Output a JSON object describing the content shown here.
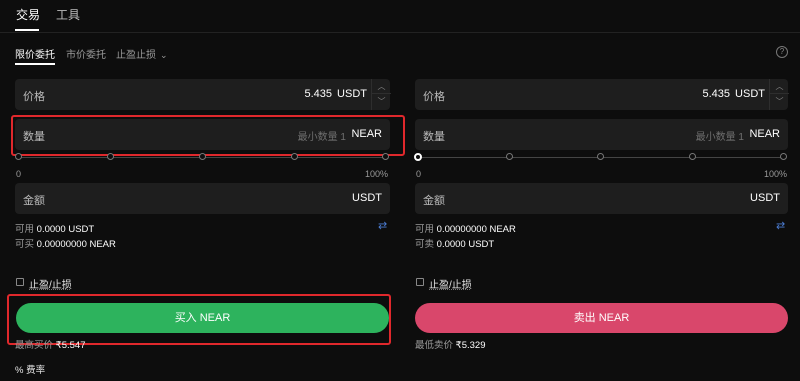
{
  "top_tabs": [
    "交易",
    "工具"
  ],
  "order_tabs": [
    "限价委托",
    "市价委托",
    "止盈止损"
  ],
  "buy": {
    "price_label": "价格",
    "price_value": "5.435",
    "price_unit": "USDT",
    "qty_label": "数量",
    "qty_placeholder": "最小数量 1",
    "qty_unit": "NEAR",
    "slider_min": "0",
    "slider_max": "100%",
    "amount_label": "金额",
    "amount_unit": "USDT",
    "avail_label": "可用",
    "avail_value": "0.0000 USDT",
    "can_label": "可买",
    "can_value": "0.00000000 NEAR",
    "tpsl_label": "止盈/止损",
    "button_label": "买入 NEAR",
    "ref_label": "最高买价",
    "ref_value": "₹5.547"
  },
  "sell": {
    "price_label": "价格",
    "price_value": "5.435",
    "price_unit": "USDT",
    "qty_label": "数量",
    "qty_placeholder": "最小数量 1",
    "qty_unit": "NEAR",
    "slider_min": "0",
    "slider_max": "100%",
    "amount_label": "金额",
    "amount_unit": "USDT",
    "avail_label": "可用",
    "avail_value": "0.00000000 NEAR",
    "can_label": "可卖",
    "can_value": "0.0000 USDT",
    "tpsl_label": "止盈/止损",
    "button_label": "卖出 NEAR",
    "ref_label": "最低卖价",
    "ref_value": "₹5.329"
  },
  "fee": {
    "icon": "%",
    "label": "费率"
  },
  "colors": {
    "buy": "#2db35d",
    "sell": "#d9476b",
    "highlight": "#e0282c",
    "background": "#0d0d0d"
  },
  "icons": [
    "help-icon",
    "chevron-down-icon",
    "swap-icon",
    "caret-up-icon",
    "caret-down-icon",
    "percent-icon"
  ]
}
